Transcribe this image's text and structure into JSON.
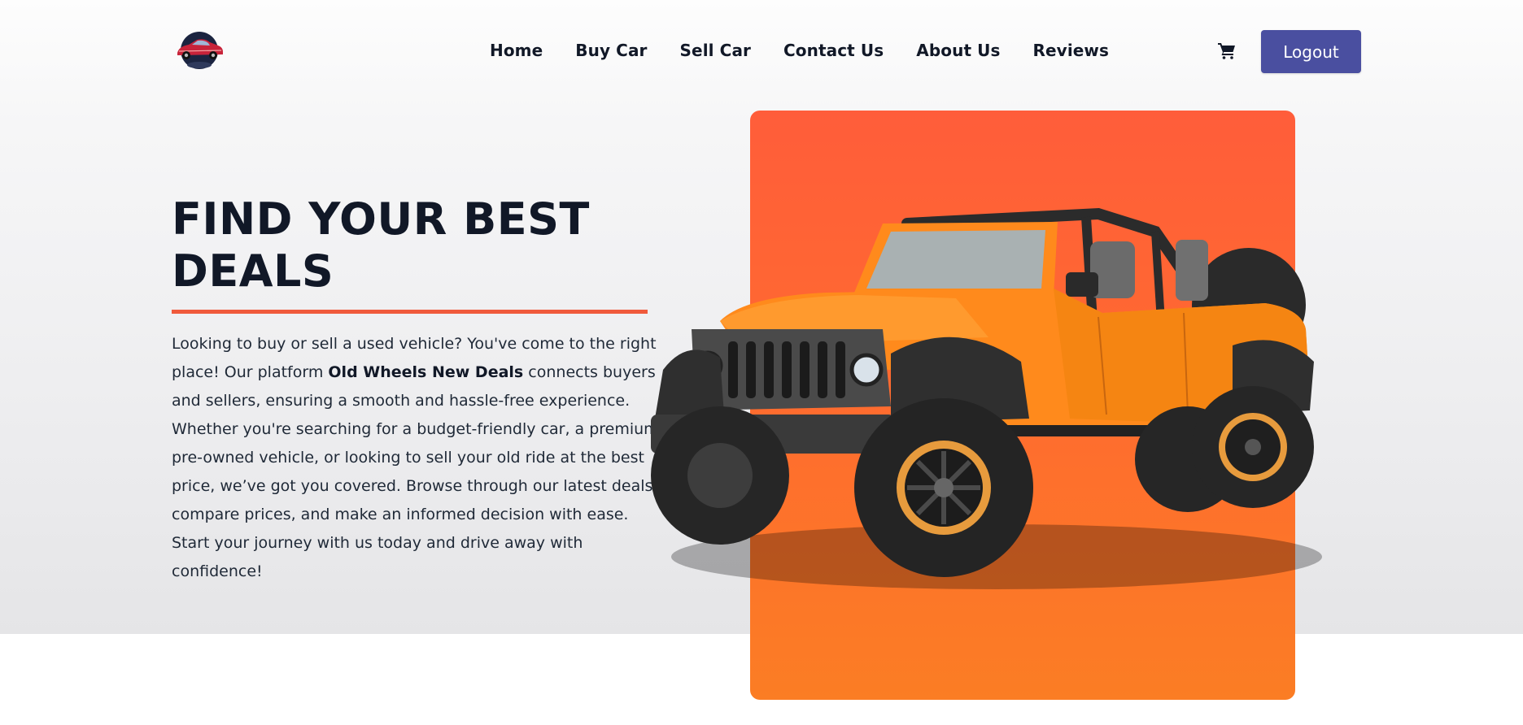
{
  "nav": {
    "logo_alt": "car-logo",
    "links": [
      "Home",
      "Buy Car",
      "Sell Car",
      "Contact Us",
      "About Us",
      "Reviews"
    ],
    "cart_icon": "cart-icon",
    "logout_label": "Logout"
  },
  "hero": {
    "title_line1": "FIND YOUR BEST",
    "title_line2": "DEALS",
    "desc_before": "Looking to buy or sell a used vehicle? You've come to the right place! Our platform ",
    "desc_brand": "Old Wheels New Deals",
    "desc_after": " connects buyers and sellers, ensuring a smooth and hassle-free experience. Whether you're searching for a budget-friendly car, a premium pre-owned vehicle, or looking to sell your old ride at the best price, we’ve got you covered. Browse through our latest deals, compare prices, and make an informed decision with ease. Start your journey with us today and drive away with confidence!",
    "image": "orange-jeep-image"
  },
  "colors": {
    "accent": "#f05a3c",
    "button": "#4a4fa0",
    "card_top": "#ff5d3a",
    "card_bottom": "#fb7d24",
    "text": "#111827"
  }
}
